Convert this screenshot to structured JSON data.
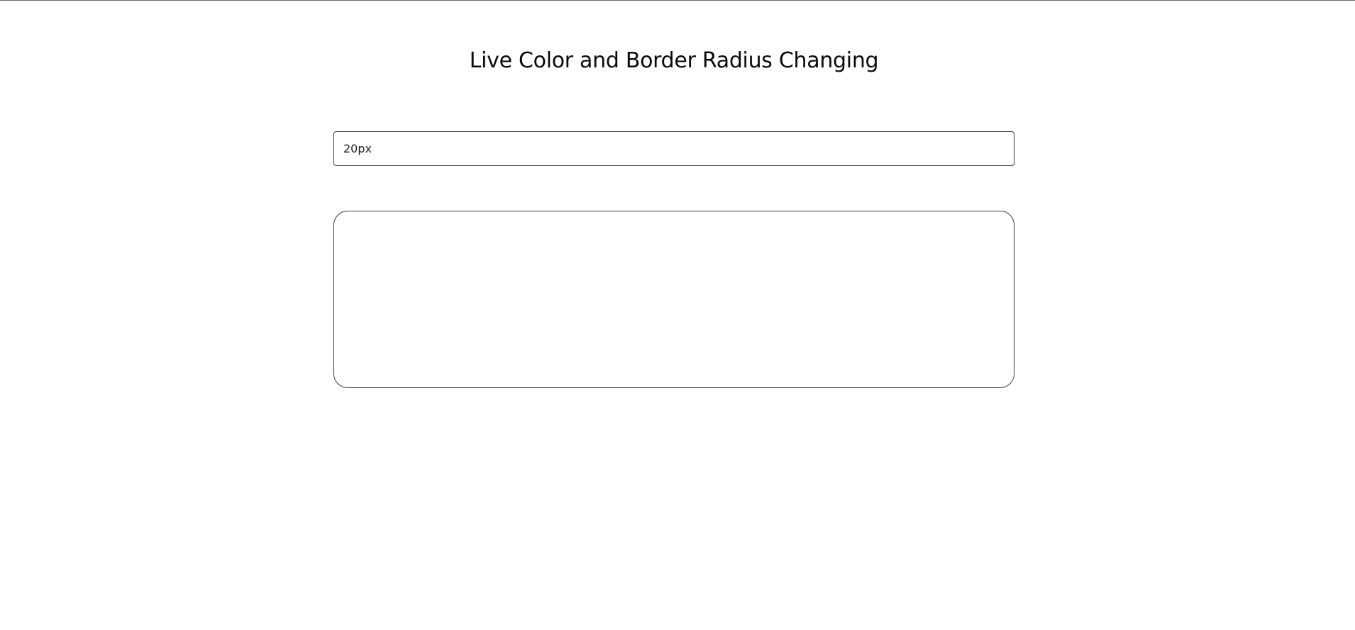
{
  "page": {
    "title": "Live Color and Border Radius Changing"
  },
  "radius_input": {
    "value": "20px",
    "placeholder": ""
  },
  "preview_box": {
    "background_color": "#ffffff",
    "border_color": "#3a3a3a"
  },
  "colors": {
    "background": "#ffffff",
    "text": "#0a0a0a",
    "border": "#3a3a3a",
    "top_rule": "#6b6b6b"
  }
}
